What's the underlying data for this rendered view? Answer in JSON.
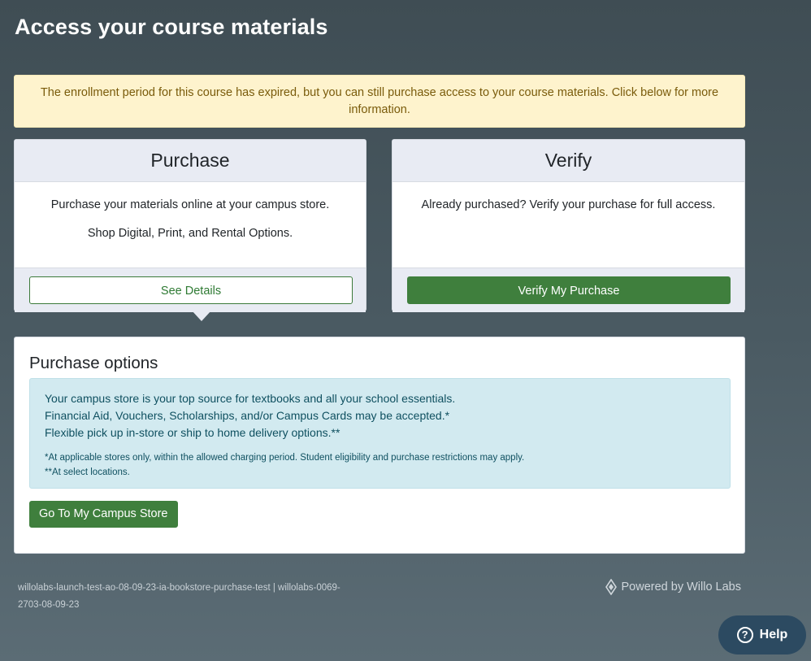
{
  "page": {
    "title": "Access your course materials"
  },
  "alert": {
    "message": "The enrollment period for this course has expired, but you can still purchase access to your course materials. Click below for more information."
  },
  "purchase_card": {
    "title": "Purchase",
    "line1": "Purchase your materials online at your campus store.",
    "line2": "Shop Digital, Print, and Rental Options.",
    "button": "See Details"
  },
  "verify_card": {
    "title": "Verify",
    "line1": "Already purchased? Verify your purchase for full access.",
    "button": "Verify My Purchase"
  },
  "options": {
    "title": "Purchase options",
    "lines": [
      "Your campus store is your top source for textbooks and all your school essentials.",
      "Financial Aid, Vouchers, Scholarships, and/or Campus Cards may be accepted.*",
      "Flexible pick up in-store or ship to home delivery options.**"
    ],
    "notes": [
      "*At applicable stores only, within the allowed charging period. Student eligibility and purchase restrictions may apply.",
      "**At select locations."
    ],
    "button": "Go To My Campus Store"
  },
  "footer": {
    "identifier": "willolabs-launch-test-ao-08-09-23-ia-bookstore-purchase-test | willolabs-0069-2703-08-09-23",
    "powered_by": "Powered by Willo Labs",
    "powered_icon": "willo-labs-logo-icon"
  },
  "help": {
    "label": "Help",
    "icon": "question-circle-icon"
  },
  "colors": {
    "primary_green": "#3f7f3d",
    "alert_bg": "#fef3cd",
    "info_bg": "#d2eaf0",
    "help_bg": "#2c4a61"
  }
}
